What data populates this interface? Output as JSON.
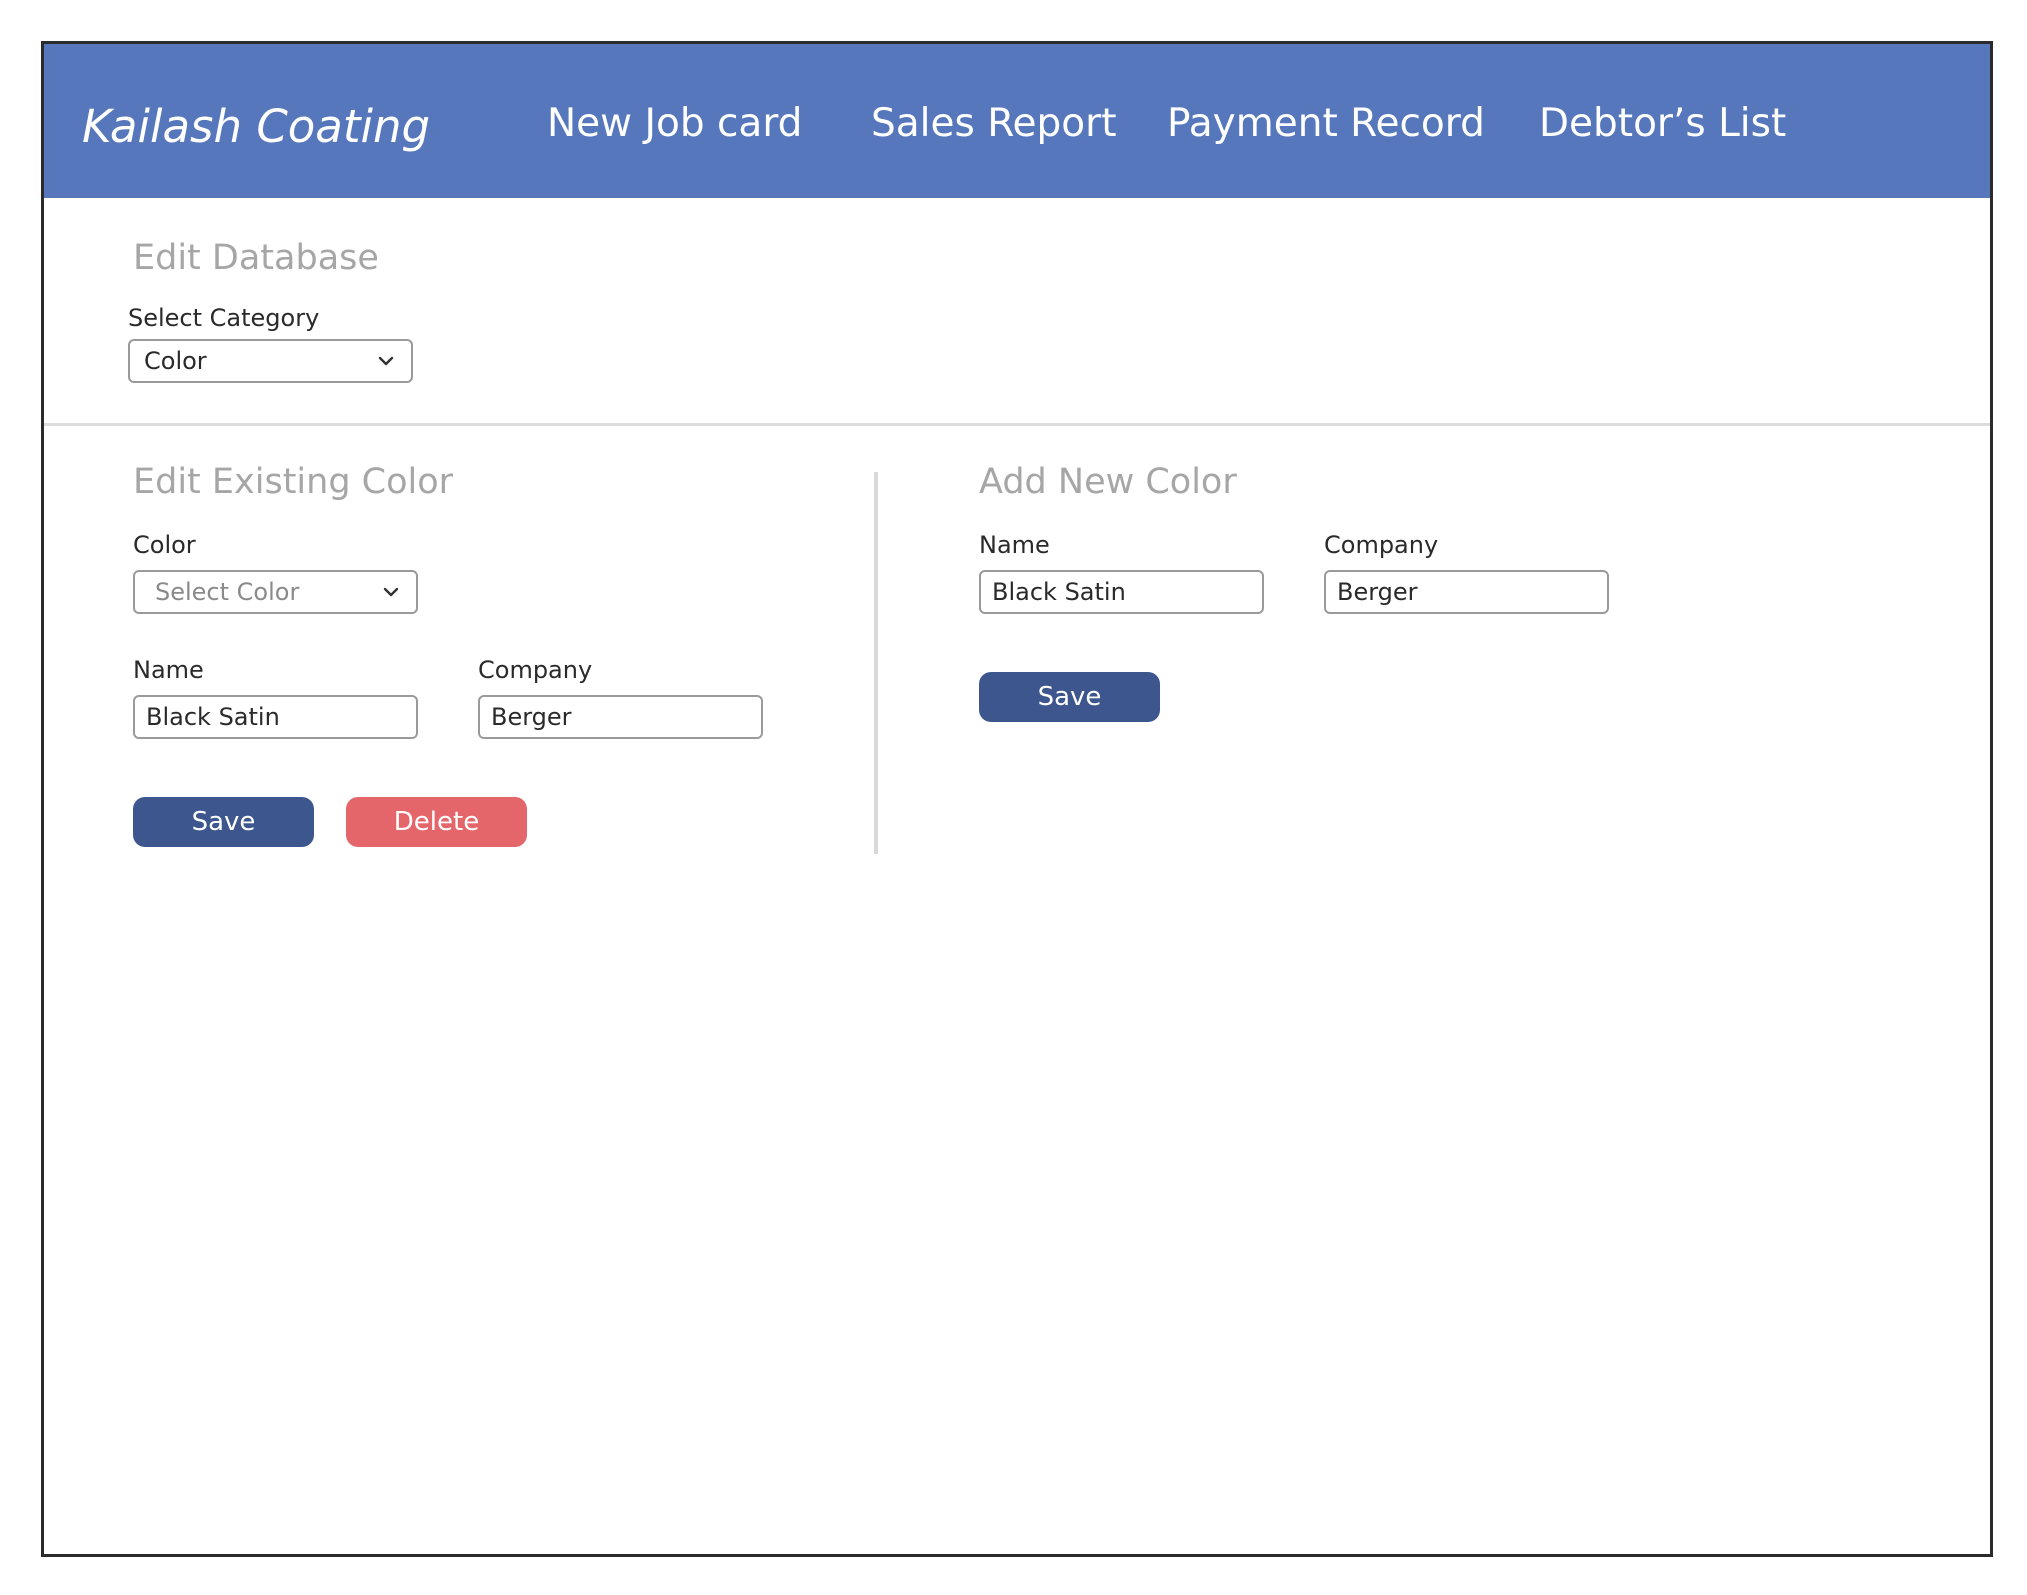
{
  "header": {
    "brand": "Kailash Coating",
    "nav": [
      {
        "label": "New Job card"
      },
      {
        "label": "Sales Report"
      },
      {
        "label": "Payment Record"
      },
      {
        "label": "Debtor’s List"
      }
    ]
  },
  "edit_database": {
    "title": "Edit Database",
    "category_label": "Select Category",
    "category_value": "Color"
  },
  "edit_existing": {
    "title": "Edit Existing Color",
    "color_label": "Color",
    "color_placeholder": "Select Color",
    "name_label": "Name",
    "name_value": "Black Satin",
    "company_label": "Company",
    "company_value": "Berger",
    "save_label": "Save",
    "delete_label": "Delete"
  },
  "add_new": {
    "title": "Add New Color",
    "name_label": "Name",
    "name_value": "Black Satin",
    "company_label": "Company",
    "company_value": "Berger",
    "save_label": "Save"
  },
  "colors": {
    "nav_bg": "#5677bb",
    "save_button": "#3d578e",
    "delete_button": "#e4666b",
    "section_title": "#a6a6a6"
  },
  "icons": {
    "dropdown": "chevron-down-icon"
  }
}
